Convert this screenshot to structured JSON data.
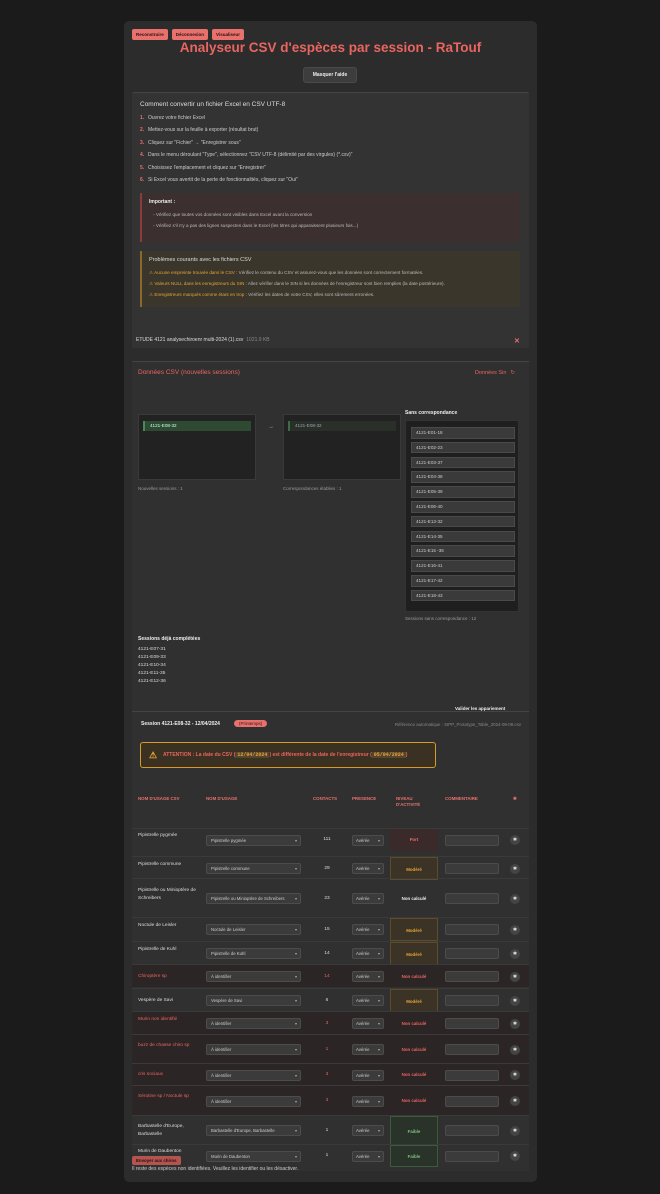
{
  "top_buttons": [
    "Reconstruire",
    "Déconnexion",
    "Visualiseur"
  ],
  "title": "Analyseur CSV d'espèces par session - RaTouf",
  "mask_button": "Masquer l'aide",
  "help": {
    "heading": "Comment convertir un fichier Excel en CSV UTF-8",
    "steps": [
      {
        "n": "1.",
        "t": "Ouvrez votre fichier Excel"
      },
      {
        "n": "2.",
        "t": "Mettez-vous sur la feuille à exporter (résultat brut)"
      },
      {
        "n": "3.",
        "t": "Cliquez sur \"Fichier\" → \"Enregistrer sous\""
      },
      {
        "n": "4.",
        "t": "Dans le menu déroulant \"Type\", sélectionnez \"CSV UTF-8 (délimité par des virgules) (*.csv)\""
      },
      {
        "n": "5.",
        "t": "Choisissez l'emplacement et cliquez sur \"Enregistrer\""
      },
      {
        "n": "6.",
        "t": "Si Excel vous avertit de la perte de fonctionnalités, cliquez sur \"Oui\""
      }
    ],
    "important_title": "Important :",
    "important": [
      "◦ Vérifiez que toutes vos données sont visibles dans Excel avant la conversion",
      "◦ Vérifiez s'il n'y a pas des lignes suspectes dans le Excel (les titres qui apparaissent plusieurs fois...)"
    ],
    "problems_title": "Problèmes courants avec les fichiers CSV",
    "problems": [
      {
        "w": "Aucune empreinte trouvée dans le CSV :",
        "t": " Vérifiez le contenu du CSV et assurez-vous que les données sont correctement formatées."
      },
      {
        "w": "Valeurs NULL dans les enregistreurs du SIN :",
        "t": " Allez vérifier dans le SIN si les données de l'enregistreur sont bien remplies (la date postérieure)."
      },
      {
        "w": "Enregistreurs marqués comme étant en trop :",
        "t": " Vérifiez les dates de votre CSV, elles sont sûrement erronées."
      }
    ]
  },
  "file": {
    "name": "ETUDE 4121 analysechiroenr multi-2024 (1).csv",
    "size": "1021.9 KB",
    "close": "✕"
  },
  "csv": {
    "heading": "Données CSV (nouvelles sessions)",
    "data_sin": "Données Sin",
    "refresh": "↻",
    "left_chip": "4121-E08-32",
    "right_chip": "4121-E08-32",
    "arrow": "→",
    "left_caption": "Nouvelles sessions : 1",
    "right_caption": "Correspondances établies : 1",
    "no_match_title": "Sans correspondance",
    "no_match": [
      "4121-E01-18",
      "4121-E02-23",
      "4121-E03-37",
      "4121-E04-38",
      "4121-E05-39",
      "4121-E06-40",
      "4121-E13-32",
      "4121-E14-35",
      "4121-E15 -36",
      "4121-E16-41",
      "4121-E17-42",
      "4121-E18-43"
    ],
    "no_match_caption": "Sessions sans correspondance : 12",
    "done_title": "Sessions déjà complétées",
    "done": [
      "4121-E07-31",
      "4121-E09-33",
      "4121-E10-34",
      "4121-E11-35",
      "4121-E12-36"
    ],
    "validate": "Valider les appariement"
  },
  "session": {
    "heading": "Session 4121-E08-32 - 12/04/2024",
    "tag": "(Printemps)",
    "ref": "Référence automatique : SIPP_Prototype_Table_2024-09-09.csv",
    "warning": {
      "pre": "ATTENTION : La date du CSV (",
      "d1": "12/04/2024",
      "mid": ") est différente de la date de l'enregistreur (",
      "d2": "05/04/2024",
      "post": ")"
    },
    "headers": [
      "NOM D'USAGE CSV",
      "NOM D'USAGE",
      "CONTACTS",
      "PRESENCE",
      "NIVEAU D'ACTIVITÉ",
      "COMMENTAIRE",
      "✱"
    ],
    "rows": [
      {
        "csv": "Pipistrelle pygmée",
        "usage": "Pipistrelle pygmée",
        "contacts": "111",
        "presence": "Avérée",
        "activity": "Fort"
      },
      {
        "csv": "Pipistrelle commune",
        "usage": "Pipistrelle commune",
        "contacts": "29",
        "presence": "Avérée",
        "activity": "Modéré"
      },
      {
        "csv": "Pipistrelle ou Minioptère de Schreibers",
        "usage": "Pipistrelle ou Minioptère de Schreibers",
        "contacts": "23",
        "presence": "Avérée",
        "activity": "Non calculé"
      },
      {
        "csv": "Noctule de Leisler",
        "usage": "Noctule de Leisler",
        "contacts": "15",
        "presence": "Avérée",
        "activity": "Modéré"
      },
      {
        "csv": "Pipistrelle de Kuhl",
        "usage": "Pipistrelle de Kuhl",
        "contacts": "14",
        "presence": "Avérée",
        "activity": "Modéré"
      },
      {
        "csv": "Chiroptère sp",
        "usage": "À identifier",
        "contacts": "14",
        "presence": "Avérée",
        "activity": "Non calculé"
      },
      {
        "csv": "Vespère de Savi",
        "usage": "Vespère de Savi",
        "contacts": "6",
        "presence": "Avérée",
        "activity": "Modéré"
      },
      {
        "csv": "Murin non identifié",
        "usage": "À identifier",
        "contacts": "3",
        "presence": "Avérée",
        "activity": "Non calculé"
      },
      {
        "csv": "buzz de chasse chiro sp",
        "usage": "À identifier",
        "contacts": "1",
        "presence": "Avérée",
        "activity": "Non calculé"
      },
      {
        "csv": "cris sociaux",
        "usage": "À identifier",
        "contacts": "3",
        "presence": "Avérée",
        "activity": "Non calculé"
      },
      {
        "csv": "Sérotine sp / Noctule sp",
        "usage": "À identifier",
        "contacts": "3",
        "presence": "Avérée",
        "activity": "Non calculé"
      },
      {
        "csv": "Barbastelle d'Europe, Barbastelle",
        "usage": "Barbastelle d'Europe, Barbastelle",
        "contacts": "1",
        "presence": "Avérée",
        "activity": "Faible"
      },
      {
        "csv": "Murin de Daubenton",
        "usage": "Murin de Daubenton",
        "contacts": "1",
        "presence": "Avérée",
        "activity": "Faible"
      }
    ]
  },
  "bottom_button": "Envoyer aux chiros",
  "bottom_text": "Il reste des espèces non identifiées. Veuillez les identifier ou les désactiver.",
  "colors": {
    "accent": "#ea6560",
    "warn": "#e8a335",
    "fort": "#e8716d",
    "modere": "#e8a335",
    "faible": "#7fbf7f"
  }
}
